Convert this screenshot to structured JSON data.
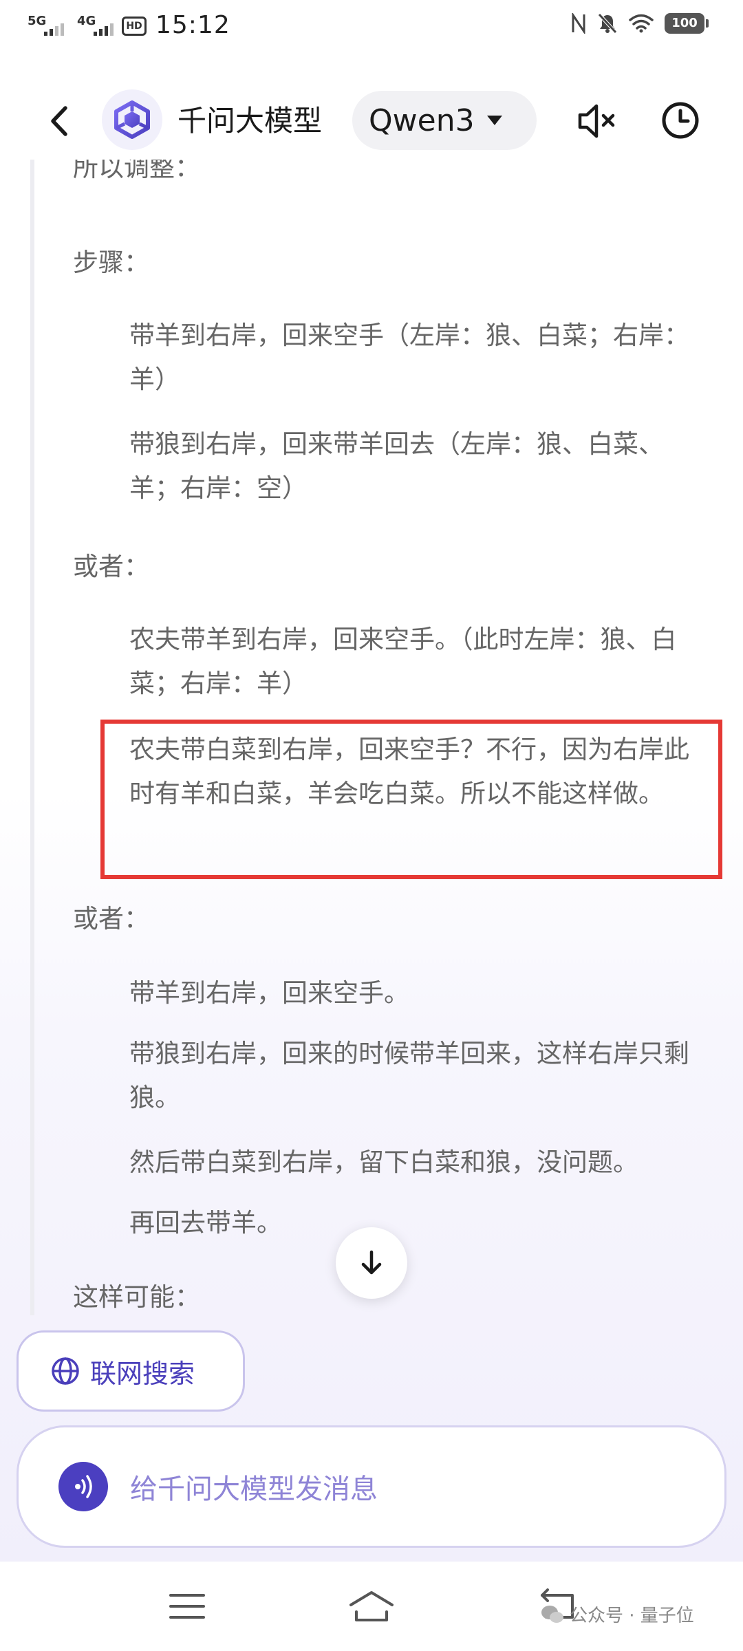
{
  "status_bar": {
    "sim1": "5G",
    "sim2": "4G",
    "hd_label": "HD",
    "time": "15:12",
    "battery": "100"
  },
  "header": {
    "app_title": "千问大模型",
    "model_selected": "Qwen3"
  },
  "messages": [
    {
      "text": "所以调整：",
      "level": 0
    },
    {
      "text": "步骤：",
      "level": 0
    },
    {
      "text": "带羊到右岸，回来空手（左岸：狼、白菜；右岸：羊）",
      "level": 1
    },
    {
      "text": "带狼到右岸，回来带羊回去（左岸：狼、白菜、羊；右岸：空）",
      "level": 1
    },
    {
      "text": "或者：",
      "level": 0
    },
    {
      "text": "农夫带羊到右岸，回来空手。（此时左岸：狼、白菜；右岸：羊）",
      "level": 1
    },
    {
      "text": "农夫带白菜到右岸，回来空手？不行，因为右岸此时有羊和白菜，羊会吃白菜。所以不能这样做。",
      "level": 1,
      "highlighted": true
    },
    {
      "text": "或者：",
      "level": 0
    },
    {
      "text": "带羊到右岸，回来空手。",
      "level": 1
    },
    {
      "text": "带狼到右岸，回来的时候带羊回来，这样右岸只剩狼。",
      "level": 1
    },
    {
      "text": "然后带白菜到右岸，留下白菜和狼，没问题。",
      "level": 1
    },
    {
      "text": "再回去带羊。",
      "level": 1
    },
    {
      "text": "这样可能：",
      "level": 0
    }
  ],
  "web_search_label": "联网搜索",
  "input_placeholder": "给千问大模型发消息",
  "watermark": "公众号 · 量子位",
  "colors": {
    "accent": "#4b3fc0",
    "highlight_border": "#e53935",
    "body_text": "#666666"
  },
  "icons": {
    "back": "chevron-left-icon",
    "logo": "qwen-logo-icon",
    "mute": "speaker-muted-icon",
    "history": "clock-icon",
    "scroll": "arrow-down-icon",
    "globe": "globe-icon",
    "voice": "voice-waves-icon"
  }
}
